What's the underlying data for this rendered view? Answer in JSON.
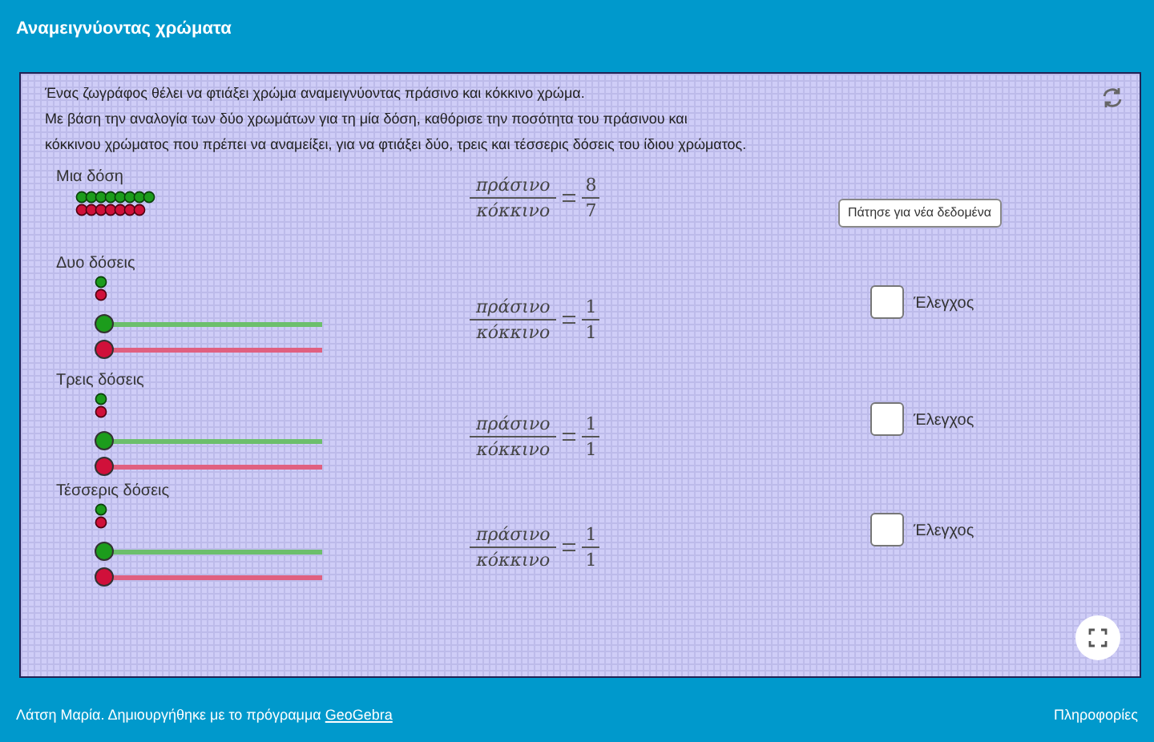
{
  "header": {
    "title": "Αναμειγνύοντας χρώματα"
  },
  "intro": [
    "Ένας ζωγράφος θέλει να φτιάξει χρώμα αναμειγνύοντας πράσινο και κόκκινο χρώμα.",
    "Με βάση την αναλογία των δύο χρωμάτων για τη μία δόση, καθόρισε την ποσότητα του πράσινου  και",
    "κόκκινου χρώματος που πρέπει να αναμείξει, για να φτιάξει δύο, τρεις και τέσσερις δόσεις του ίδιου χρώματος."
  ],
  "new_data_button": "Πάτησε για νέα δεδομένα",
  "doses": [
    {
      "kind": "beads",
      "label": "Μια δόση",
      "numerator_word": "πράσινο",
      "denominator_word": "κόκκινο",
      "numerator": "8",
      "denominator": "7"
    },
    {
      "kind": "sliders",
      "label": "Δυο δόσεις",
      "numerator_word": "πράσινο",
      "denominator_word": "κόκκινο",
      "numerator": "1",
      "denominator": "1",
      "sliders": [
        {
          "kind": "green",
          "level": 0
        },
        {
          "kind": "red",
          "level": 0
        }
      ],
      "check_label": "Έλεγχος",
      "checked": false
    },
    {
      "kind": "sliders",
      "label": "Τρεις δόσεις",
      "numerator_word": "πράσινο",
      "denominator_word": "κόκκινο",
      "numerator": "1",
      "denominator": "1",
      "sliders": [
        {
          "kind": "green",
          "level": 0
        },
        {
          "kind": "red",
          "level": 0
        }
      ],
      "check_label": "Έλεγχος",
      "checked": false
    },
    {
      "kind": "sliders",
      "label": "Τέσσερις δόσεις",
      "numerator_word": "πράσινο",
      "denominator_word": "κόκκινο",
      "numerator": "1",
      "denominator": "1",
      "sliders": [
        {
          "kind": "green",
          "level": 0
        },
        {
          "kind": "red",
          "level": 0
        }
      ],
      "check_label": "Έλεγχος",
      "checked": false
    }
  ],
  "footer": {
    "credit": "Λάτση Μαρία. Δημιουργήθηκε με το πρόγραμμα ",
    "credit_link": "GeoGebra",
    "info_link": "Πληροφορίες"
  }
}
